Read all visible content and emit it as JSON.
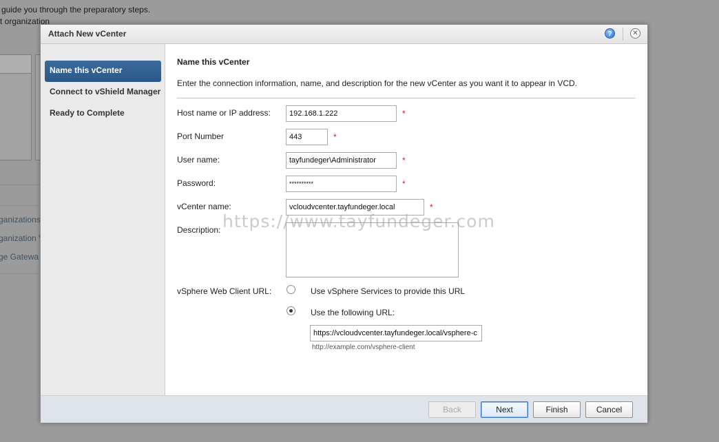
{
  "background": {
    "line1": "guide you through the preparatory steps.",
    "line2": "t organization",
    "nav": [
      "ganizations",
      "ganization V",
      "ge Gatewa"
    ]
  },
  "dialog": {
    "title": "Attach New vCenter",
    "help_icon": "?",
    "close_icon": "✕",
    "steps": [
      {
        "label": "Name this vCenter",
        "active": true
      },
      {
        "label": "Connect to vShield Manager",
        "active": false
      },
      {
        "label": "Ready to Complete",
        "active": false
      }
    ],
    "section_title": "Name this vCenter",
    "section_desc": "Enter the connection information, name, and description for the new vCenter as you want it to appear in VCD.",
    "form": {
      "host": {
        "label": "Host name or IP address:",
        "value": "192.168.1.222",
        "required": "*"
      },
      "port": {
        "label": "Port Number",
        "value": "443",
        "required": "*"
      },
      "user": {
        "label": "User name:",
        "value": "tayfundeger\\Administrator",
        "required": "*"
      },
      "password": {
        "label": "Password:",
        "value": "**********",
        "required": "*"
      },
      "vcenter_name": {
        "label": "vCenter name:",
        "value": "vcloudvcenter.tayfundeger.local",
        "required": "*"
      },
      "description": {
        "label": "Description:",
        "value": ""
      },
      "web_client": {
        "label": "vSphere Web Client URL:",
        "option_services": "Use vSphere Services to provide this URL",
        "option_url": "Use the following URL:",
        "selected": "option_url",
        "url_value": "https://vcloudvcenter.tayfundeger.local/vsphere-c",
        "url_hint": "http://example.com/vsphere-client"
      }
    },
    "watermark": "https://www.tayfundeger.com",
    "buttons": {
      "back": "Back",
      "next": "Next",
      "finish": "Finish",
      "cancel": "Cancel"
    }
  }
}
